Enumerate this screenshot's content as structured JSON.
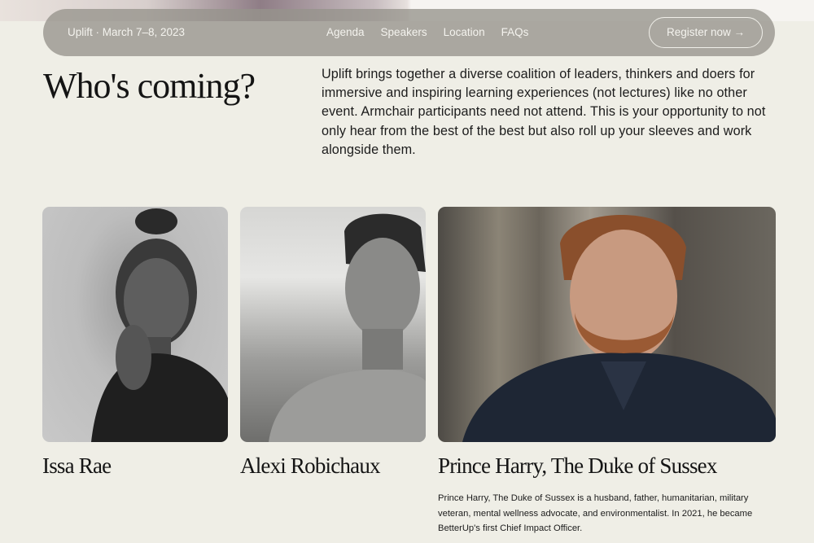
{
  "nav": {
    "brand": "Uplift · March 7–8, 2023",
    "links": [
      "Agenda",
      "Speakers",
      "Location",
      "FAQs"
    ],
    "cta": "Register now →"
  },
  "section": {
    "title": "Who's coming?",
    "intro": "Uplift brings together a diverse coalition of leaders, thinkers and doers for immersive and inspiring learning experiences (not lectures) like no other event. Armchair participants need not attend. This is your opportunity to not only hear from the best of the best but also roll up your sleeves and work alongside them."
  },
  "speakers": [
    {
      "name": "Issa Rae",
      "bio": ""
    },
    {
      "name": "Alexi Robichaux",
      "bio": ""
    },
    {
      "name": "Prince Harry, The Duke of Sussex",
      "bio": "Prince Harry, The Duke of Sussex is a husband, father, humanitarian, military veteran, mental wellness advocate, and environmentalist. In 2021, he became BetterUp's first Chief Impact Officer."
    }
  ],
  "colors": {
    "background": "#efeee6",
    "nav_bg": "#96948c",
    "nav_text": "#f4f3ee",
    "text": "#1c1c1c"
  }
}
